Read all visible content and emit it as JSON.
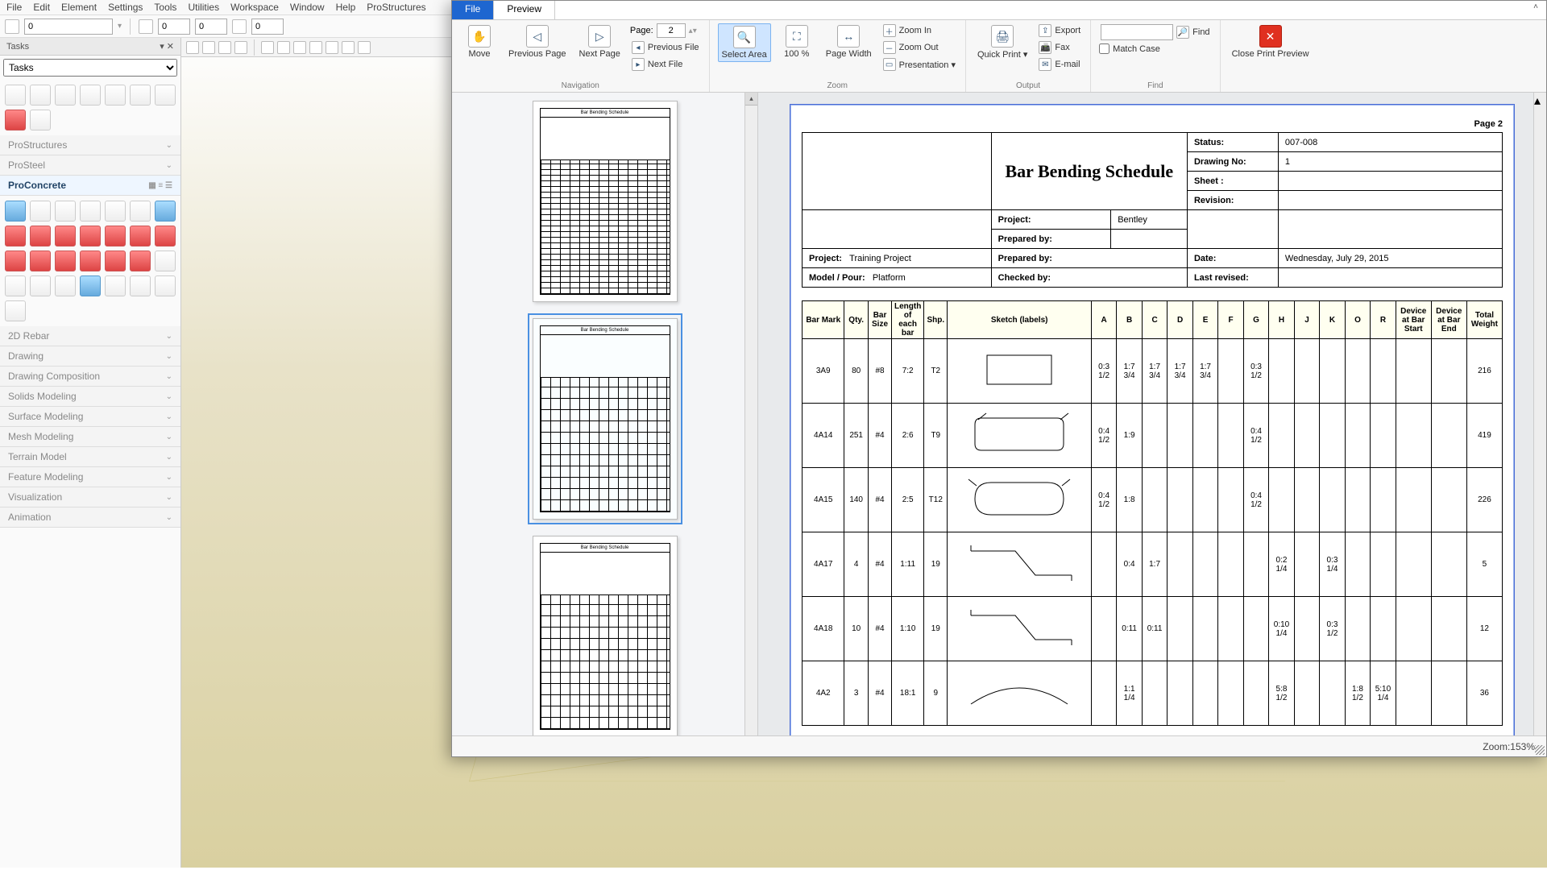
{
  "menubar": [
    "File",
    "Edit",
    "Element",
    "Settings",
    "Tools",
    "Utilities",
    "Workspace",
    "Window",
    "Help",
    "ProStructures"
  ],
  "tasks": {
    "title": "Tasks",
    "combo": "Tasks",
    "sections": [
      {
        "label": "ProStructures",
        "active": false
      },
      {
        "label": "ProSteel",
        "active": false
      },
      {
        "label": "ProConcrete",
        "active": true
      },
      {
        "label": "2D Rebar",
        "active": false
      },
      {
        "label": "Drawing",
        "active": false
      },
      {
        "label": "Drawing Composition",
        "active": false
      },
      {
        "label": "Solids Modeling",
        "active": false
      },
      {
        "label": "Surface Modeling",
        "active": false
      },
      {
        "label": "Mesh Modeling",
        "active": false
      },
      {
        "label": "Terrain Model",
        "active": false
      },
      {
        "label": "Feature Modeling",
        "active": false
      },
      {
        "label": "Visualization",
        "active": false
      },
      {
        "label": "Animation",
        "active": false
      }
    ]
  },
  "preview": {
    "tabs": {
      "file": "File",
      "preview": "Preview"
    },
    "ribbon": {
      "nav": {
        "move": "Move",
        "prev": "Previous Page",
        "next": "Next Page",
        "page_label": "Page:",
        "page_value": "2",
        "prev_file": "Previous File",
        "next_file": "Next File",
        "group": "Navigation"
      },
      "zoom": {
        "select": "Select Area",
        "p100": "100 %",
        "pwidth": "Page Width",
        "zin": "Zoom In",
        "zout": "Zoom Out",
        "present": "Presentation ▾",
        "group": "Zoom"
      },
      "output": {
        "quick": "Quick Print ▾",
        "export": "Export",
        "fax": "Fax",
        "email": "E-mail",
        "group": "Output"
      },
      "find": {
        "find": "Find",
        "match": "Match Case",
        "group": "Find"
      },
      "close": {
        "label": "Close Print Preview"
      }
    },
    "page_label": "Page 2",
    "header": {
      "title": "Bar Bending Schedule",
      "fields": {
        "status_l": "Status:",
        "status_v": "007-008",
        "drawing_l": "Drawing No:",
        "drawing_v": "1",
        "sheet_l": "Sheet :",
        "sheet_v": "",
        "revision_l": "Revision:",
        "revision_v": "",
        "project_l": "Project:",
        "project_v": "Bentley",
        "prepared_l": "Prepared by:",
        "prepared_v": "",
        "date_l": "Date:",
        "date_v": "Wednesday, July 29, 2015",
        "project2_l": "Project:",
        "project2_v": "Training Project",
        "model_l": "Model / Pour:",
        "model_v": "Platform",
        "checked_l": "Checked by:",
        "checked_v": "",
        "last_l": "Last revised:",
        "last_v": ""
      }
    },
    "columns": [
      "Bar Mark",
      "Qty.",
      "Bar Size",
      "Length of each bar",
      "Shp.",
      "Sketch (labels)",
      "A",
      "B",
      "C",
      "D",
      "E",
      "F",
      "G",
      "H",
      "J",
      "K",
      "O",
      "R",
      "Device at Bar Start",
      "Device at Bar End",
      "Total Weight"
    ],
    "rows": [
      {
        "mark": "3A9",
        "qty": "80",
        "size": "#8",
        "len": "7:2",
        "shp": "T2",
        "A": "0:3 1/2",
        "B": "1:7 3/4",
        "C": "1:7 3/4",
        "D": "1:7 3/4",
        "E": "1:7 3/4",
        "F": "",
        "G": "0:3 1/2",
        "H": "",
        "J": "",
        "K": "",
        "O": "",
        "R": "",
        "ds": "",
        "de": "",
        "wt": "216",
        "sk": "rect"
      },
      {
        "mark": "4A14",
        "qty": "251",
        "size": "#4",
        "len": "2:6",
        "shp": "T9",
        "A": "0:4 1/2",
        "B": "1:9",
        "C": "",
        "D": "",
        "E": "",
        "F": "",
        "G": "0:4 1/2",
        "H": "",
        "J": "",
        "K": "",
        "O": "",
        "R": "",
        "ds": "",
        "de": "",
        "wt": "419",
        "sk": "stirrup"
      },
      {
        "mark": "4A15",
        "qty": "140",
        "size": "#4",
        "len": "2:5",
        "shp": "T12",
        "A": "0:4 1/2",
        "B": "1:8",
        "C": "",
        "D": "",
        "E": "",
        "F": "",
        "G": "0:4 1/2",
        "H": "",
        "J": "",
        "K": "",
        "O": "",
        "R": "",
        "ds": "",
        "de": "",
        "wt": "226",
        "sk": "stirrup2"
      },
      {
        "mark": "4A17",
        "qty": "4",
        "size": "#4",
        "len": "1:11",
        "shp": "19",
        "A": "",
        "B": "0:4",
        "C": "1:7",
        "D": "",
        "E": "",
        "F": "",
        "G": "",
        "H": "0:2 1/4",
        "J": "",
        "K": "0:3 1/4",
        "O": "",
        "R": "",
        "ds": "",
        "de": "",
        "wt": "5",
        "sk": "zig"
      },
      {
        "mark": "4A18",
        "qty": "10",
        "size": "#4",
        "len": "1:10",
        "shp": "19",
        "A": "",
        "B": "0:11",
        "C": "0:11",
        "D": "",
        "E": "",
        "F": "",
        "G": "",
        "H": "0:10 1/4",
        "J": "",
        "K": "0:3 1/2",
        "O": "",
        "R": "",
        "ds": "",
        "de": "",
        "wt": "12",
        "sk": "zig"
      },
      {
        "mark": "4A2",
        "qty": "3",
        "size": "#4",
        "len": "18:1",
        "shp": "9",
        "A": "",
        "B": "1:1 1/4",
        "C": "",
        "D": "",
        "E": "",
        "F": "",
        "G": "",
        "H": "5:8 1/2",
        "J": "",
        "K": "",
        "O": "1:8 1/2",
        "R": "5:10 1/4",
        "ds": "",
        "de": "",
        "wt": "36",
        "sk": "arc"
      }
    ],
    "status": {
      "zoom_l": "Zoom: ",
      "zoom_v": "153%"
    }
  }
}
